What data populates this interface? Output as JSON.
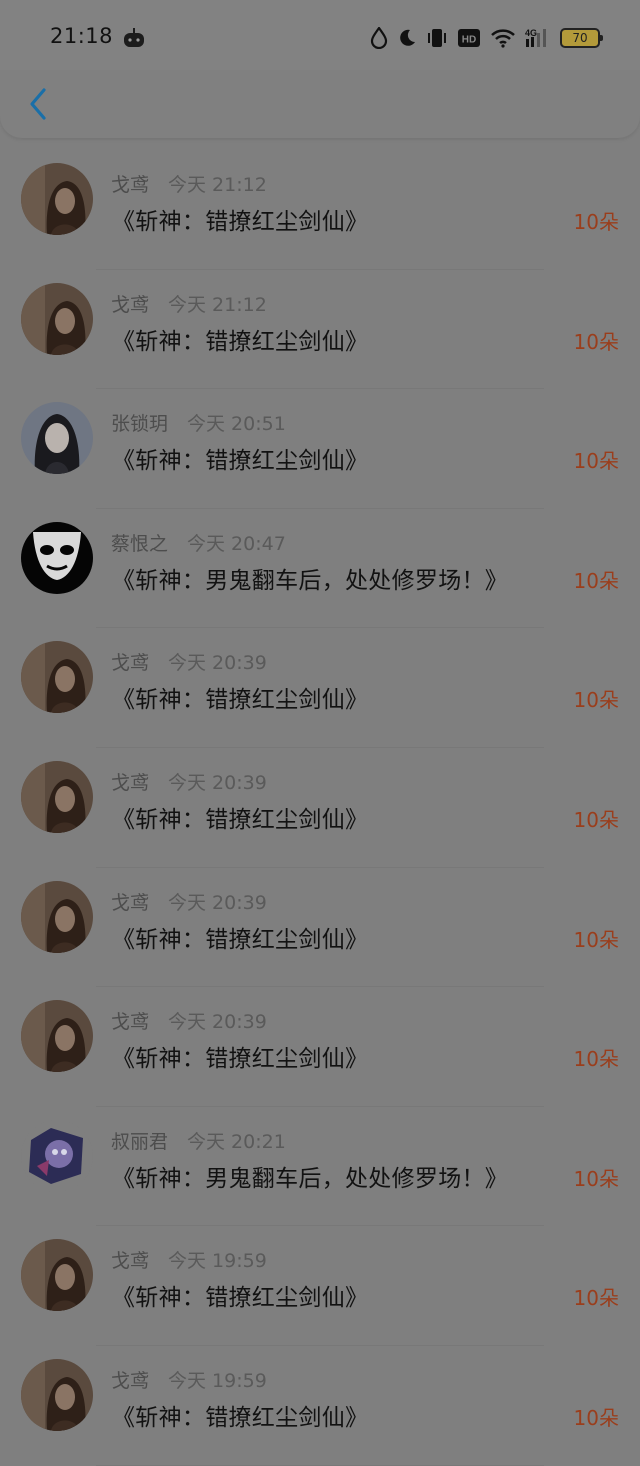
{
  "status_bar": {
    "time": "21:18",
    "battery": "70",
    "network": "4G",
    "hd": "HD"
  },
  "nav": {
    "back_icon": "chevron-left-icon",
    "accent_color": "#1a6fa8"
  },
  "records": [
    {
      "user": "戈鸢",
      "time": "今天 21:12",
      "title": "《斩神：错撩红尘剑仙》",
      "amount": "10朵",
      "avatar": "girl-photo"
    },
    {
      "user": "戈鸢",
      "time": "今天 21:12",
      "title": "《斩神：错撩红尘剑仙》",
      "amount": "10朵",
      "avatar": "girl-photo"
    },
    {
      "user": "张锁玥",
      "time": "今天 20:51",
      "title": "《斩神：错撩红尘剑仙》",
      "amount": "10朵",
      "avatar": "dark-hair-girl"
    },
    {
      "user": "蔡恨之",
      "time": "今天 20:47",
      "title": "《斩神：男鬼翻车后，处处修罗场！》",
      "amount": "10朵",
      "avatar": "mask-face"
    },
    {
      "user": "戈鸢",
      "time": "今天 20:39",
      "title": "《斩神：错撩红尘剑仙》",
      "amount": "10朵",
      "avatar": "girl-photo"
    },
    {
      "user": "戈鸢",
      "time": "今天 20:39",
      "title": "《斩神：错撩红尘剑仙》",
      "amount": "10朵",
      "avatar": "girl-photo"
    },
    {
      "user": "戈鸢",
      "time": "今天 20:39",
      "title": "《斩神：错撩红尘剑仙》",
      "amount": "10朵",
      "avatar": "girl-photo"
    },
    {
      "user": "戈鸢",
      "time": "今天 20:39",
      "title": "《斩神：错撩红尘剑仙》",
      "amount": "10朵",
      "avatar": "girl-photo"
    },
    {
      "user": "叔丽君",
      "time": "今天 20:21",
      "title": "《斩神：男鬼翻车后，处处修罗场！》",
      "amount": "10朵",
      "avatar": "anime-sticker"
    },
    {
      "user": "戈鸢",
      "time": "今天 19:59",
      "title": "《斩神：错撩红尘剑仙》",
      "amount": "10朵",
      "avatar": "girl-photo"
    },
    {
      "user": "戈鸢",
      "time": "今天 19:59",
      "title": "《斩神：错撩红尘剑仙》",
      "amount": "10朵",
      "avatar": "girl-photo"
    }
  ]
}
